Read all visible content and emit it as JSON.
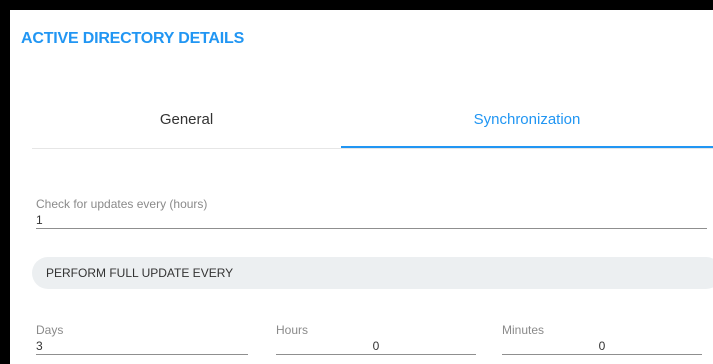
{
  "header": {
    "title": "ACTIVE DIRECTORY DETAILS"
  },
  "tabs": [
    {
      "label": "General",
      "active": false
    },
    {
      "label": "Synchronization",
      "active": true
    }
  ],
  "sync": {
    "check_updates": {
      "label": "Check for updates every (hours)",
      "value": "1"
    },
    "full_update_section": "PERFORM FULL UPDATE EVERY",
    "days": {
      "label": "Days",
      "value": "3"
    },
    "hours": {
      "label": "Hours",
      "value": "0"
    },
    "minutes": {
      "label": "Minutes",
      "value": "0"
    }
  },
  "colors": {
    "accent": "#2196f3",
    "section_bg": "#eceff1"
  }
}
